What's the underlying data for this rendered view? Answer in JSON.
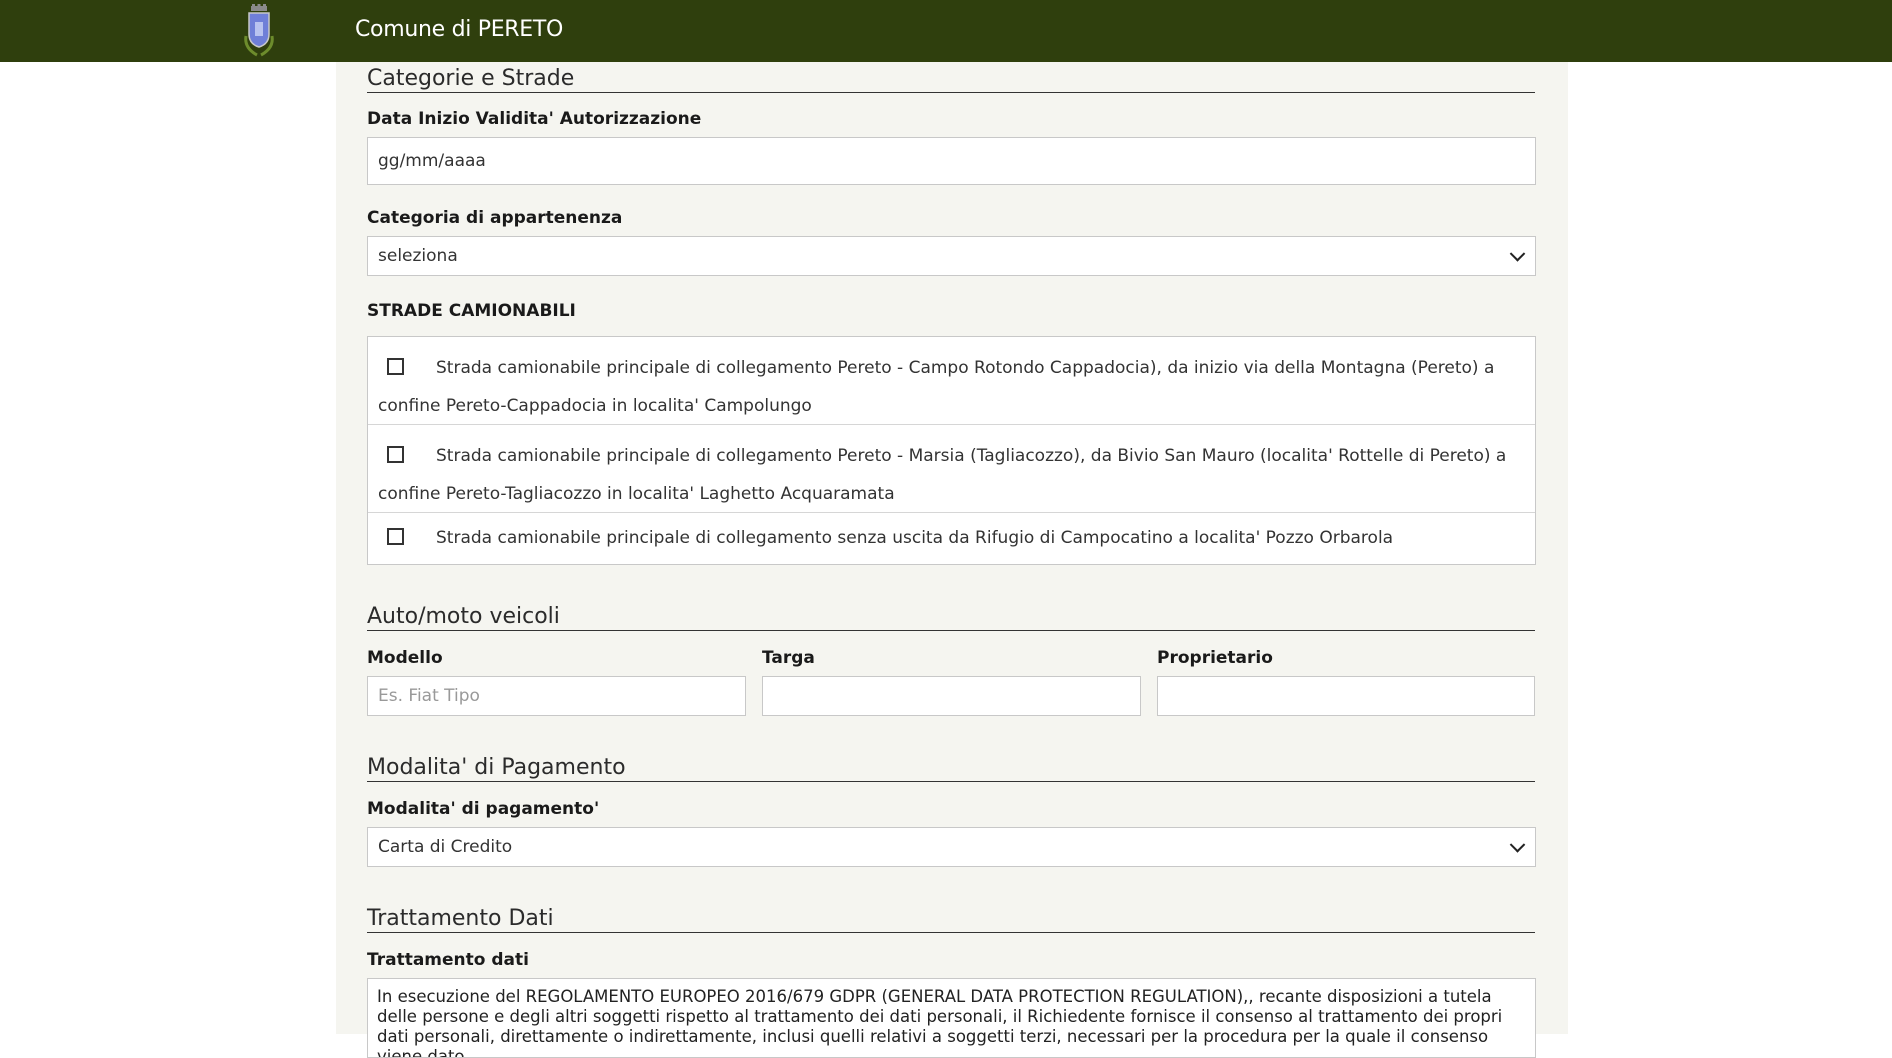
{
  "header": {
    "title": "Comune di PERETO",
    "logo_icon": "municipal-crest-icon",
    "bar_color": "#2f3f0d"
  },
  "sections": {
    "categorie": {
      "title": "Categorie e Strade",
      "data_label": "Data Inizio Validita' Autorizzazione",
      "data_placeholder": "gg/mm/aaaa",
      "categoria_label": "Categoria di appartenenza",
      "categoria_value": "seleziona",
      "strade_heading": "STRADE CAMIONABILI",
      "strade": [
        {
          "label": "Strada camionabile principale di collegamento Pereto - Campo Rotondo Cappadocia), da inizio via della Montagna (Pereto) a confine Pereto-Cappadocia in localita' Campolungo",
          "checked": false
        },
        {
          "label": "Strada camionabile principale di collegamento Pereto - Marsia (Tagliacozzo), da Bivio San Mauro (localita' Rottelle di Pereto) a confine Pereto-Tagliacozzo in localita' Laghetto Acquaramata",
          "checked": false
        },
        {
          "label": "Strada camionabile principale di collegamento senza uscita da Rifugio di Campocatino a localita' Pozzo Orbarola",
          "checked": false
        }
      ]
    },
    "veicoli": {
      "title": "Auto/moto veicoli",
      "modello_label": "Modello",
      "modello_placeholder": "Es. Fiat Tipo",
      "targa_label": "Targa",
      "targa_value": "",
      "proprietario_label": "Proprietario",
      "proprietario_value": ""
    },
    "pagamento": {
      "title": "Modalita' di Pagamento",
      "label": "Modalita' di pagamento'",
      "value": "Carta di Credito"
    },
    "trattamento": {
      "title": "Trattamento Dati",
      "label": "Trattamento dati",
      "text": "In esecuzione del  REGOLAMENTO EUROPEO 2016/679 GDPR (GENERAL DATA PROTECTION REGULATION),, recante disposizioni a tutela delle persone e degli altri soggetti rispetto al trattamento dei dati personali, il Richiedente fornisce il consenso al trattamento dei propri dati personali, direttamente o indirettamente, inclusi quelli relativi a soggetti terzi, necessari per la procedura per la quale il consenso viene dato."
    }
  }
}
